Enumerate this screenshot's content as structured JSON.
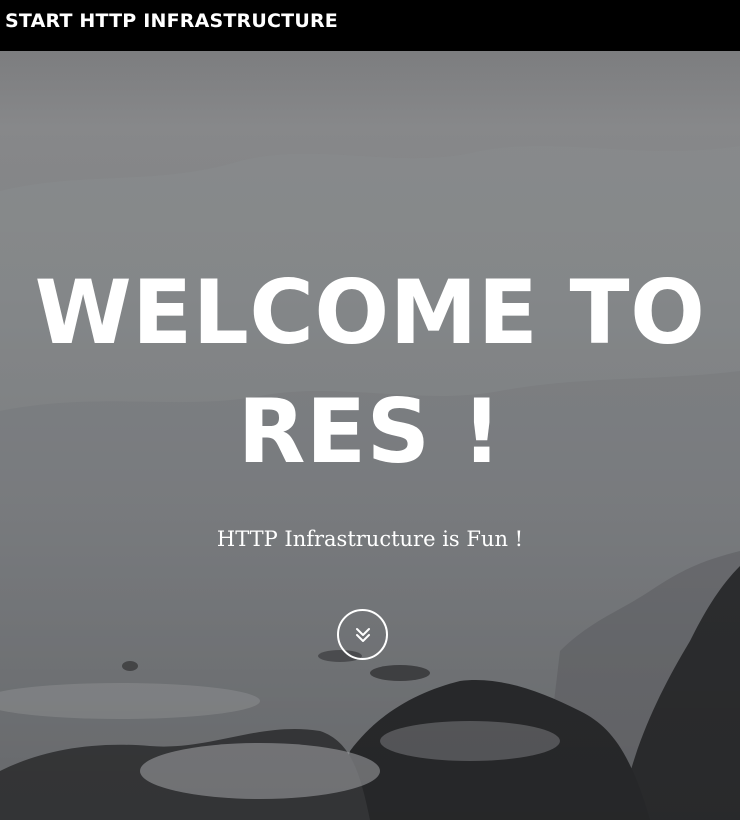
{
  "navbar": {
    "brand": "START HTTP INFRASTRUCTURE"
  },
  "hero": {
    "headline_line1": "WELCOME TO",
    "headline_line2": "RES !",
    "tagline": "HTTP Infrastructure is Fun !",
    "scroll_icon": "double-chevron-down-icon",
    "background": "misty-coastal-rocks-photo"
  },
  "colors": {
    "navbar_bg": "#000000",
    "text": "#ffffff"
  }
}
